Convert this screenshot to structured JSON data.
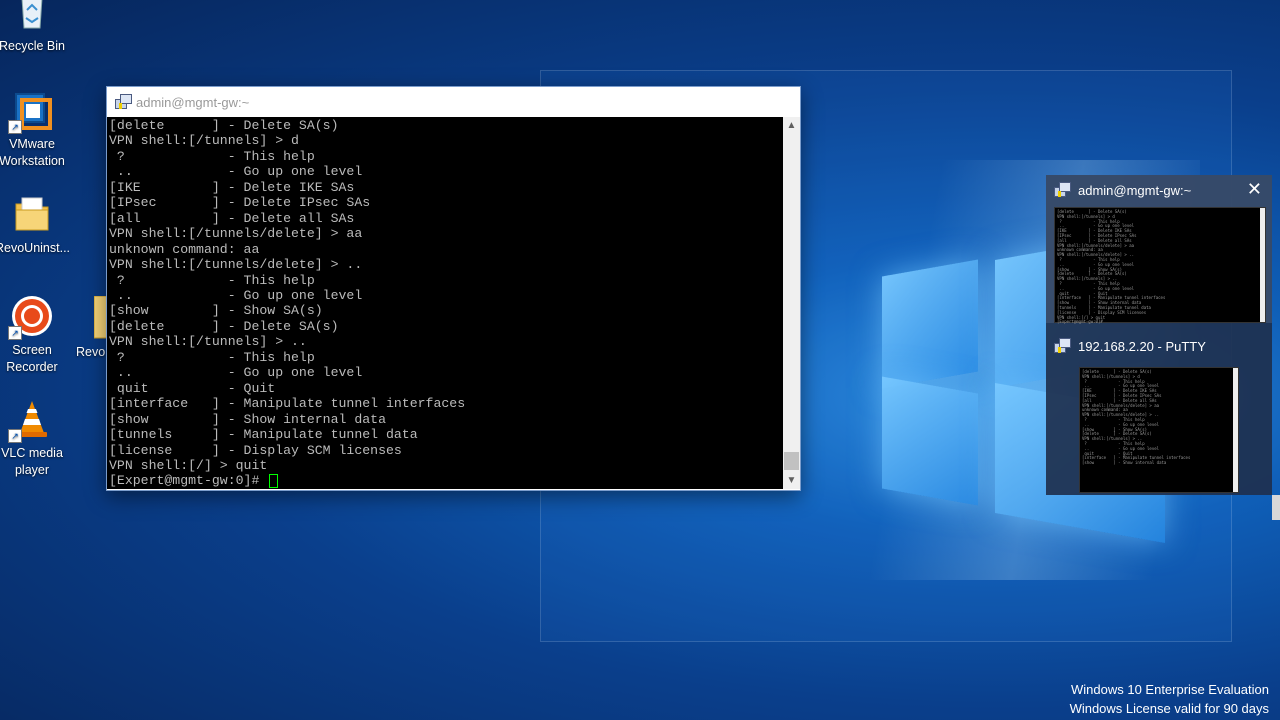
{
  "desktop": {
    "icons": [
      {
        "label": "Recycle Bin",
        "icon": "recycle-bin-icon"
      },
      {
        "label": "VMware Workstation",
        "icon": "vmware-icon"
      },
      {
        "label": "RevoUninst...",
        "icon": "folder-icon"
      },
      {
        "label": "Revo",
        "icon": "folder-icon"
      },
      {
        "label": "Screen Recorder",
        "icon": "screen-recorder-icon"
      },
      {
        "label": "VLC media player",
        "icon": "vlc-icon"
      }
    ]
  },
  "putty_window": {
    "title": "admin@mgmt-gw:~",
    "terminal_lines": [
      "[delete      ] - Delete SA(s)",
      "VPN shell:[/tunnels] > d",
      " ?             - This help",
      " ..            - Go up one level",
      "[IKE         ] - Delete IKE SAs",
      "[IPsec       ] - Delete IPsec SAs",
      "[all         ] - Delete all SAs",
      "VPN shell:[/tunnels/delete] > aa",
      "unknown command: aa",
      "VPN shell:[/tunnels/delete] > ..",
      " ?             - This help",
      " ..            - Go up one level",
      "[show        ] - Show SA(s)",
      "[delete      ] - Delete SA(s)",
      "VPN shell:[/tunnels] > ..",
      " ?             - This help",
      " ..            - Go up one level",
      " quit          - Quit",
      "[interface   ] - Manipulate tunnel interfaces",
      "[show        ] - Show internal data",
      "[tunnels     ] - Manipulate tunnel data",
      "[license     ] - Display SCM licenses",
      "VPN shell:[/] > quit"
    ],
    "prompt": "[Expert@mgmt-gw:0]#"
  },
  "taskbar_preview": {
    "items": [
      {
        "title": "admin@mgmt-gw:~"
      },
      {
        "title": "192.168.2.20 - PuTTY"
      }
    ],
    "close_glyph": "✕"
  },
  "watermark": {
    "line1": "Windows 10 Enterprise Evaluation",
    "line2": "Windows License valid for 90 days"
  },
  "colors": {
    "terminal_bg": "#000000",
    "terminal_fg": "#bbbbbb",
    "cursor": "#00ff00",
    "desktop_blue": "#0a3f8c"
  }
}
